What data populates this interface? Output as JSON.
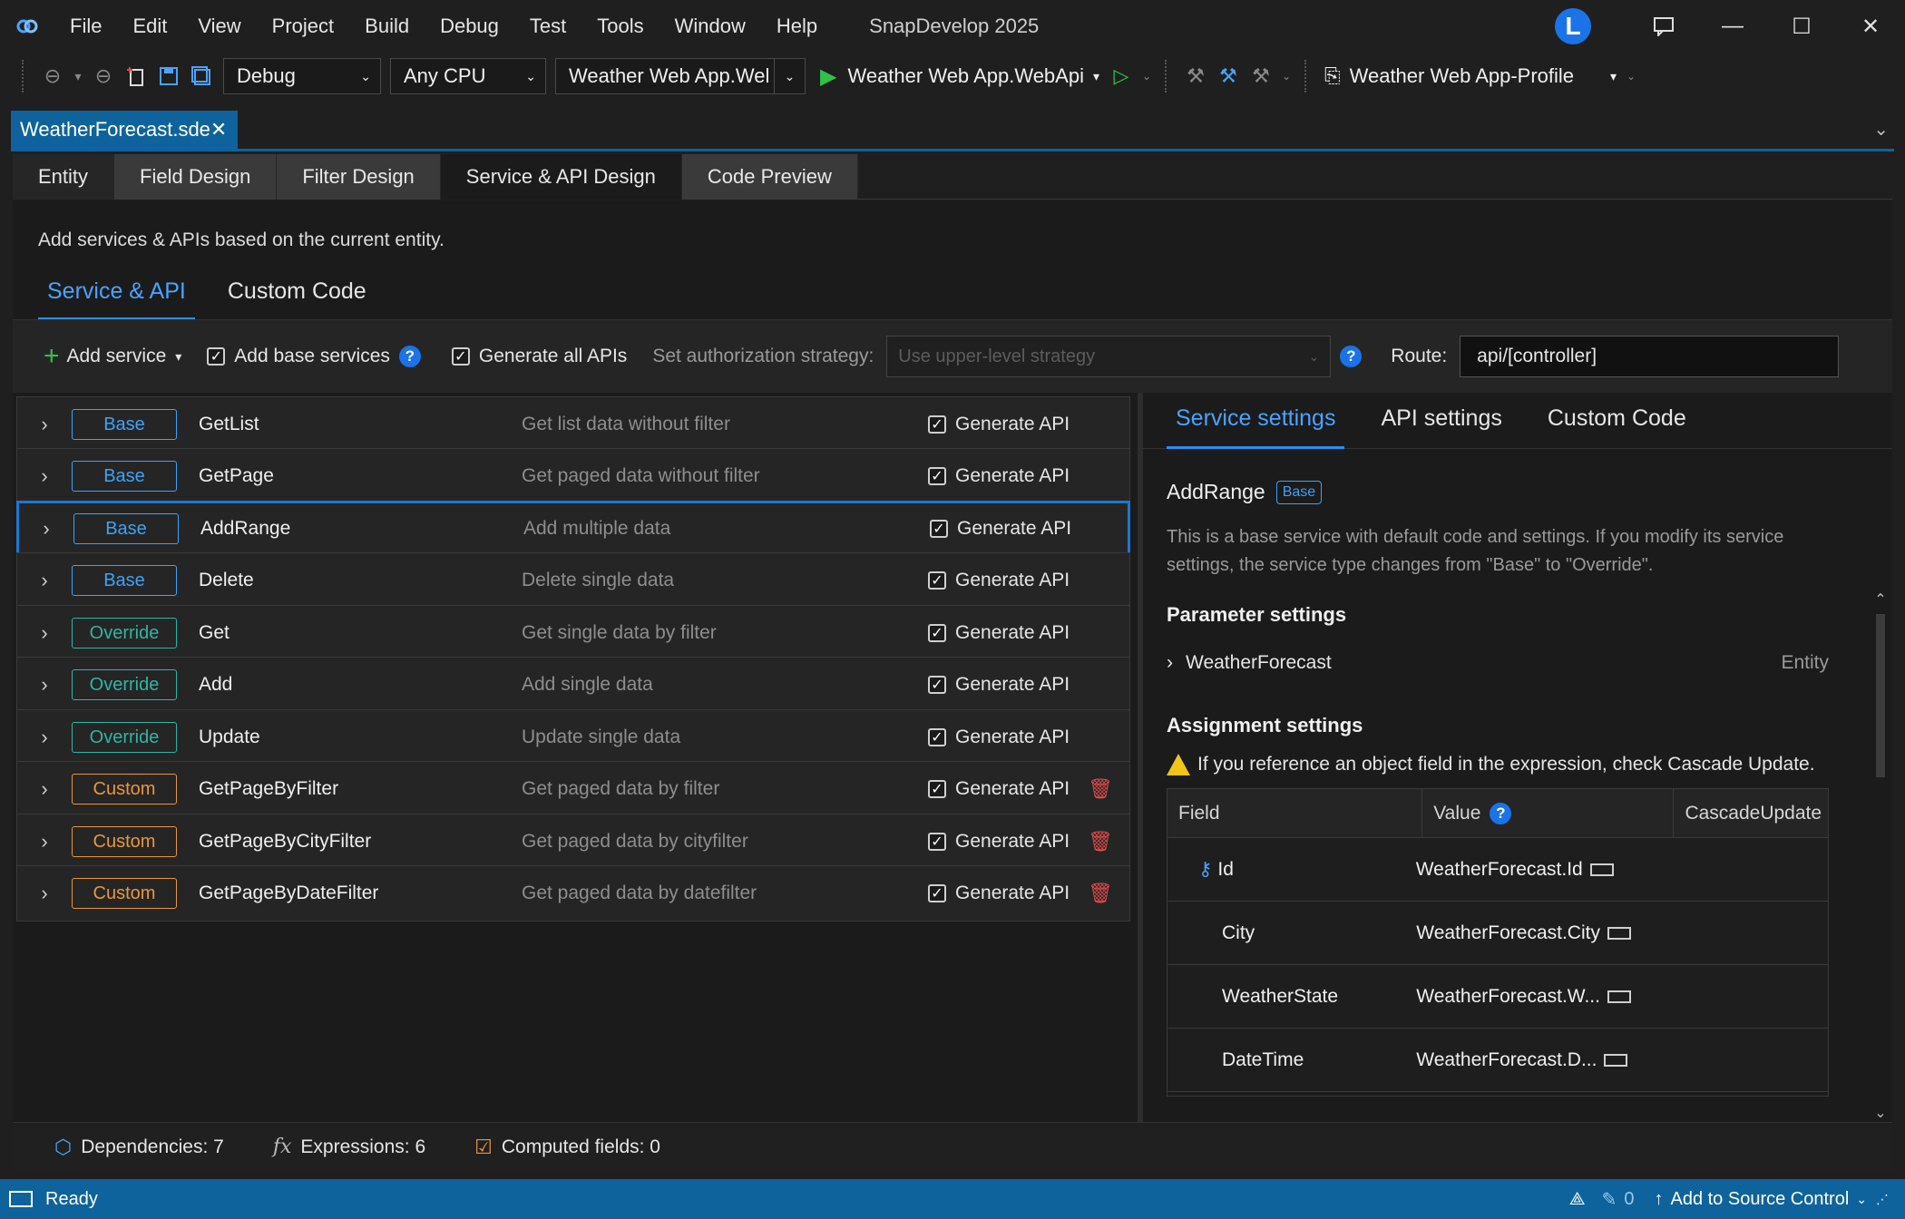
{
  "titlebar": {
    "menu": [
      "File",
      "Edit",
      "View",
      "Project",
      "Build",
      "Debug",
      "Test",
      "Tools",
      "Window",
      "Help"
    ],
    "app_title": "SnapDevelop 2025",
    "avatar_initial": "L"
  },
  "toolbar": {
    "config": "Debug",
    "platform": "Any CPU",
    "startup_project": "Weather Web App.Wel",
    "run_target": "Weather Web App.WebApi",
    "profile": "Weather Web App-Profile"
  },
  "document_tab": {
    "label": "WeatherForecast.sde"
  },
  "designer_tabs": [
    "Entity",
    "Field Design",
    "Filter Design",
    "Service & API Design",
    "Code Preview"
  ],
  "main": {
    "description": "Add services & APIs based on the current entity.",
    "subtabs": [
      "Service & API",
      "Custom Code"
    ],
    "options": {
      "add_service": "Add service",
      "add_base_services": "Add base services",
      "generate_all_apis": "Generate all APIs",
      "auth_label": "Set authorization strategy:",
      "auth_placeholder": "Use upper-level strategy",
      "route_label": "Route:",
      "route_value": "api/[controller]"
    },
    "generate_label": "Generate API",
    "services": [
      {
        "type": "Base",
        "name": "GetList",
        "desc": "Get list data without filter",
        "deletable": false
      },
      {
        "type": "Base",
        "name": "GetPage",
        "desc": "Get paged data without filter",
        "deletable": false
      },
      {
        "type": "Base",
        "name": "AddRange",
        "desc": "Add multiple data",
        "deletable": false
      },
      {
        "type": "Base",
        "name": "Delete",
        "desc": "Delete single data",
        "deletable": false
      },
      {
        "type": "Override",
        "name": "Get",
        "desc": "Get single data by filter",
        "deletable": false
      },
      {
        "type": "Override",
        "name": "Add",
        "desc": "Add single data",
        "deletable": false
      },
      {
        "type": "Override",
        "name": "Update",
        "desc": "Update single data",
        "deletable": false
      },
      {
        "type": "Custom",
        "name": "GetPageByFilter",
        "desc": "Get paged data by filter",
        "deletable": true
      },
      {
        "type": "Custom",
        "name": "GetPageByCityFilter",
        "desc": "Get paged data by cityfilter",
        "deletable": true
      },
      {
        "type": "Custom",
        "name": "GetPageByDateFilter",
        "desc": "Get paged data by datefilter",
        "deletable": true
      }
    ]
  },
  "right_panel": {
    "tabs": [
      "Service settings",
      "API settings",
      "Custom Code"
    ],
    "title": "AddRange",
    "badge": "Base",
    "info": "This is a base service with default code and settings. If you modify its service settings, the service type changes from \"Base\" to \"Override\".",
    "param_heading": "Parameter settings",
    "param_name": "WeatherForecast",
    "param_type": "Entity",
    "assign_heading": "Assignment settings",
    "warning": "If you reference an object field in the expression, check Cascade Update.",
    "columns": [
      "Field",
      "Value",
      "CascadeUpdate"
    ],
    "rows": [
      {
        "field": "Id",
        "value": "WeatherForecast.Id"
      },
      {
        "field": "City",
        "value": "WeatherForecast.City"
      },
      {
        "field": "WeatherState",
        "value": "WeatherForecast.W..."
      },
      {
        "field": "DateTime",
        "value": "WeatherForecast.D..."
      }
    ]
  },
  "infobar": {
    "dependencies": "Dependencies: 7",
    "expressions": "Expressions: 6",
    "computed": "Computed fields: 0"
  },
  "statusbar": {
    "ready": "Ready",
    "errors": "0",
    "source_control": "Add to Source Control"
  },
  "colors": {
    "accent": "#0e639c",
    "base": "#3ea2f5",
    "override": "#2fb5a2",
    "custom": "#e8963d",
    "delete": "#e04a4a"
  }
}
